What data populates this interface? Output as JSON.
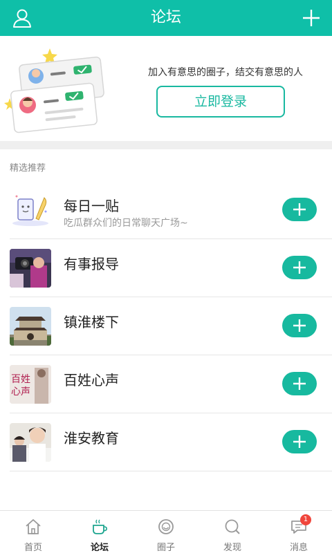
{
  "header": {
    "title": "论坛"
  },
  "banner": {
    "slogan": "加入有意思的圈子，结交有意思的人",
    "login_label": "立即登录"
  },
  "section": {
    "title": "精选推荐"
  },
  "forums": [
    {
      "name": "每日一贴",
      "desc": "吃瓜群众们的日常聊天广场~"
    },
    {
      "name": "有事报导",
      "desc": ""
    },
    {
      "name": "镇淮楼下",
      "desc": ""
    },
    {
      "name": "百姓心声",
      "desc": "",
      "thumb_text": "百姓心声"
    },
    {
      "name": "淮安教育",
      "desc": ""
    }
  ],
  "tabs": [
    {
      "label": "首页",
      "icon": "home-icon"
    },
    {
      "label": "论坛",
      "icon": "coffee-cup-icon"
    },
    {
      "label": "圈子",
      "icon": "smile-circle-icon"
    },
    {
      "label": "发现",
      "icon": "search-icon"
    },
    {
      "label": "消息",
      "icon": "chat-bubble-icon",
      "badge": "1"
    }
  ],
  "colors": {
    "primary": "#0fbfa8",
    "badge": "#f0463c"
  }
}
